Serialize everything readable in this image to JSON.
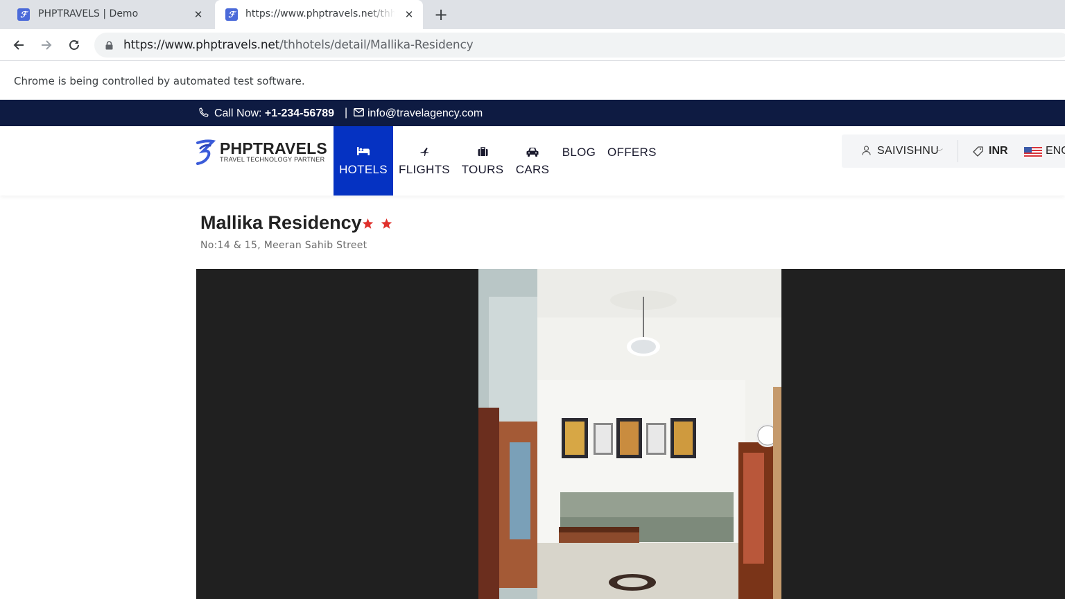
{
  "browser": {
    "tabs": [
      {
        "title": "PHPTRAVELS | Demo",
        "active": false
      },
      {
        "title": "https://www.phptravels.net/thhotels/detail/Mallika-Residency",
        "active": true
      }
    ],
    "url_host": "https://www.phptravels.net",
    "url_path": "/thhotels/detail/Mallika-Residency",
    "infobar_text": "Chrome is being controlled by automated test software."
  },
  "topbar": {
    "call_label": "Call Now:",
    "phone": "+1-234-56789",
    "separator": "|",
    "email": "info@travelagency.com"
  },
  "header": {
    "logo_name": "PHPTRAVELS",
    "logo_tagline": "TRAVEL TECHNOLOGY PARTNER",
    "nav": [
      {
        "label": "HOTELS",
        "icon": "bed-icon",
        "active": true
      },
      {
        "label": "FLIGHTS",
        "icon": "plane-icon",
        "active": false
      },
      {
        "label": "TOURS",
        "icon": "suitcase-icon",
        "active": false
      },
      {
        "label": "CARS",
        "icon": "car-icon",
        "active": false
      },
      {
        "label": "BLOG",
        "active": false
      },
      {
        "label": "OFFERS",
        "active": false
      }
    ],
    "user": "SAIVISHNU",
    "currency": "INR",
    "language": "ENG"
  },
  "hotel": {
    "name": "Mallika Residency",
    "stars": 2,
    "address": "No:14 & 15, Meeran Sahib Street"
  },
  "colors": {
    "topbar_bg": "#0e1b42",
    "nav_active_bg": "#0532c2",
    "star": "#e0302b",
    "gallery_bg": "#202020"
  }
}
